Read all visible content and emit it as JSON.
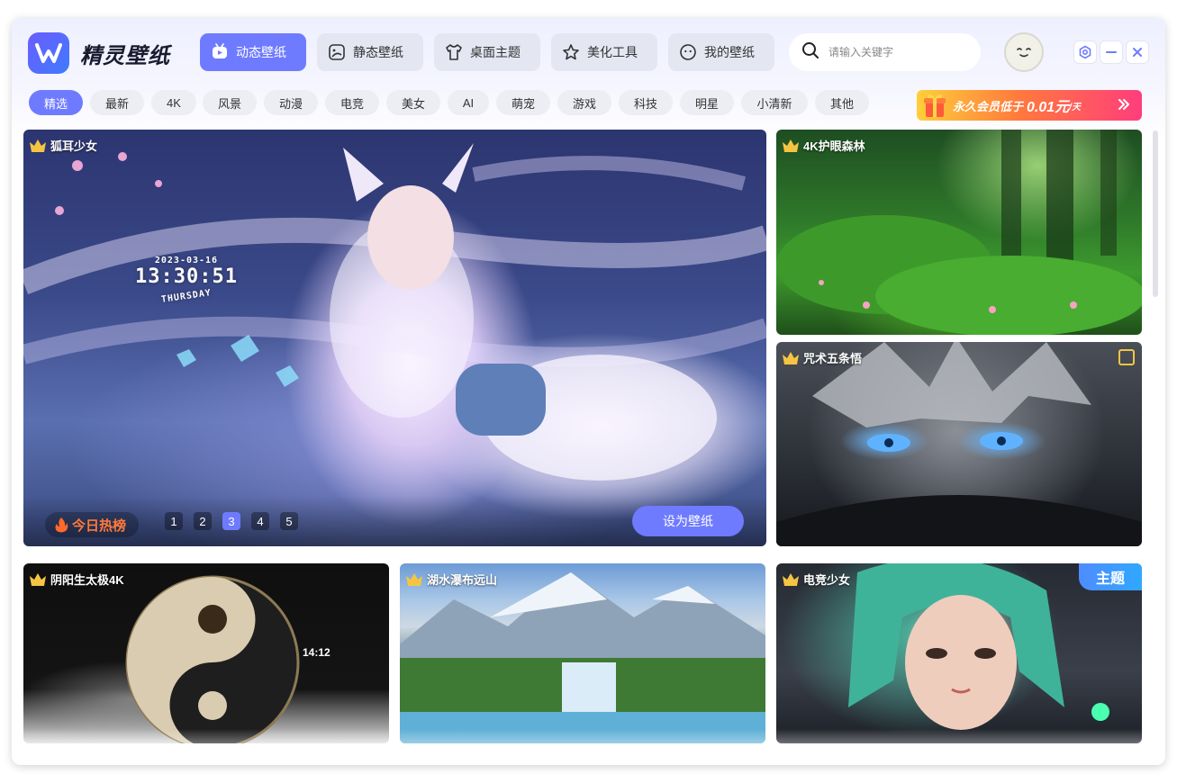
{
  "app": {
    "brand": "精灵壁纸"
  },
  "nav": [
    {
      "label": "动态壁纸",
      "icon": "video-icon",
      "active": true
    },
    {
      "label": "静态壁纸",
      "icon": "image-icon",
      "active": false
    },
    {
      "label": "桌面主题",
      "icon": "tshirt-icon",
      "active": false
    },
    {
      "label": "美化工具",
      "icon": "star-icon",
      "active": false
    },
    {
      "label": "我的壁纸",
      "icon": "smile-icon",
      "active": false
    }
  ],
  "search": {
    "placeholder": "请输入关键字",
    "value": ""
  },
  "categories": [
    "精选",
    "最新",
    "4K",
    "风景",
    "动漫",
    "电竞",
    "美女",
    "AI",
    "萌宠",
    "游戏",
    "科技",
    "明星",
    "小清新",
    "其他"
  ],
  "promo": {
    "text": "永久会员低于",
    "price": "0.01元",
    "unit": "/天"
  },
  "hero": {
    "title": "狐耳少女",
    "clock_date": "2023-03-16",
    "clock_time": "13:30:51",
    "clock_day": "THURSDAY",
    "hot_label": "今日热榜",
    "pages": [
      "1",
      "2",
      "3",
      "4",
      "5"
    ],
    "current_page": "3",
    "set_label": "设为壁纸"
  },
  "cards": [
    {
      "title": "4K护眼森林"
    },
    {
      "title": "咒术五条悟"
    },
    {
      "title": "阴阳生太极4K",
      "clock": "14:12"
    },
    {
      "title": "湖水瀑布远山"
    },
    {
      "title": "电竞少女",
      "tag": "主题"
    }
  ],
  "colors": {
    "accent": "#6f7bff",
    "crown": "#f5c542",
    "hot": "#ff7a3a"
  }
}
